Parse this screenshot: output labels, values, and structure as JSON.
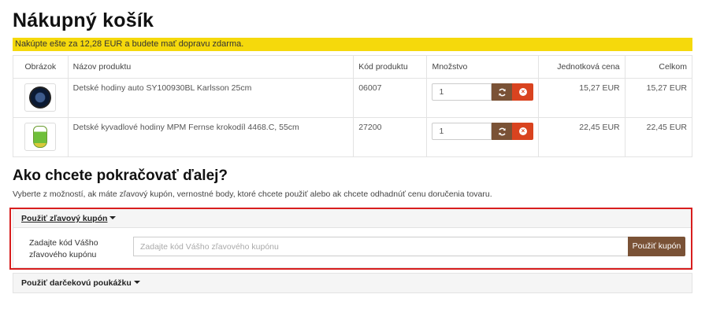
{
  "page_title": "Nákupný košík",
  "alert_text": "Nakúpte ešte za 12,28 EUR a budete mať dopravu zdarma.",
  "cart": {
    "headers": {
      "image": "Obrázok",
      "name": "Názov produktu",
      "code": "Kód produktu",
      "qty": "Množstvo",
      "unit": "Jednotková cena",
      "total": "Celkom"
    },
    "rows": [
      {
        "thumb_icon": "clock-thumbnail",
        "name": "Detské hodiny auto SY100930BL Karlsson 25cm",
        "code": "06007",
        "qty": "1",
        "unit": "15,27 EUR",
        "total": "15,27 EUR"
      },
      {
        "thumb_icon": "crocodile-clock-thumbnail",
        "name": "Detské kyvadlové hodiny MPM Fernse krokodíl 4468.C, 55cm",
        "code": "27200",
        "qty": "1",
        "unit": "22,45 EUR",
        "total": "22,45 EUR"
      }
    ]
  },
  "next": {
    "title": "Ako chcete pokračovať ďalej?",
    "description": "Vyberte z možností, ak máte zľavový kupón, vernostné body, ktoré chcete použiť alebo ak chcete odhadnúť cenu doručenia tovaru."
  },
  "coupon": {
    "heading": "Použiť zľavový kupón",
    "label": "Zadajte kód Vášho zľavového kupónu",
    "placeholder": "Zadajte kód Vášho zľavového kupónu",
    "button": "Použiť kupón"
  },
  "gift": {
    "heading": "Použiť darčekovú poukážku"
  },
  "colors": {
    "alert_bg": "#f5d90c",
    "brown_button": "#7a5236",
    "remove_button": "#d9431f",
    "highlight_border": "#d81e1e"
  }
}
